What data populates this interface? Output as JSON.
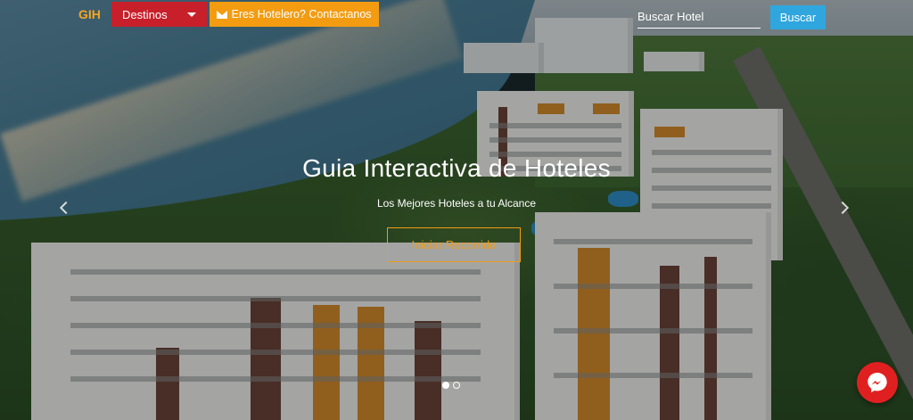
{
  "navbar": {
    "brand": "GIH",
    "destinations_label": "Destinos",
    "contact_label": "Eres Hotelero? Contactanos",
    "search_placeholder": "Buscar Hotel",
    "search_button": "Buscar"
  },
  "hero": {
    "title": "Guia Interactiva de Hoteles",
    "subtitle": "Los Mejores Hoteles a tu Alcance",
    "cta_label": "Iniciar Recorrido"
  },
  "carousel": {
    "slide_count": 2,
    "active_index": 0
  },
  "icons": {
    "contact": "envelope-icon",
    "destinations": "caret-down-icon",
    "chat": "messenger-icon",
    "prev": "chevron-left-icon",
    "next": "chevron-right-icon"
  },
  "colors": {
    "brand": "#f5a623",
    "destinations_bg": "#c8202a",
    "contact_bg": "#f39c12",
    "search_bg": "#2fa6de",
    "messenger_bg": "#e02020"
  }
}
